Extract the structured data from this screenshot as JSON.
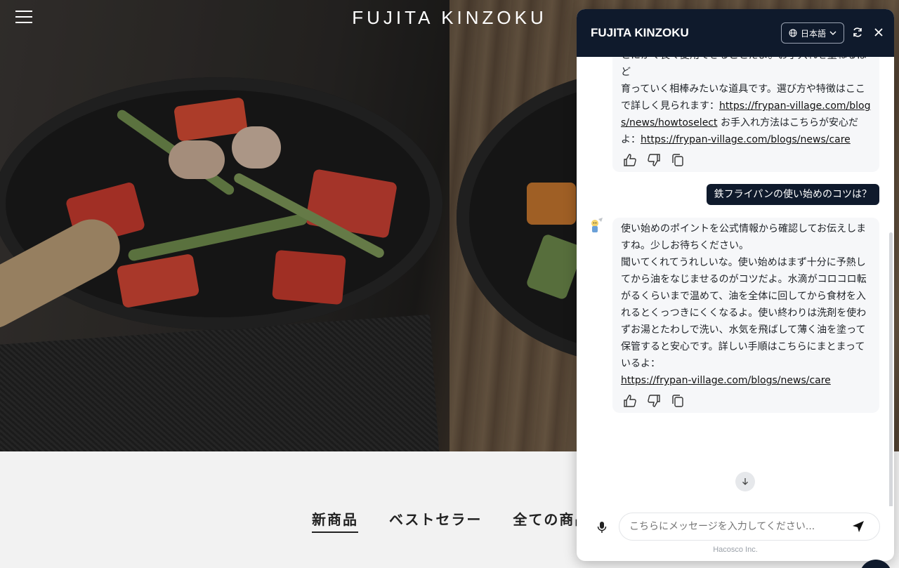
{
  "site": {
    "brand": "FUJITA KINZOKU",
    "tabs": [
      {
        "label": "新商品",
        "active": true
      },
      {
        "label": "ベストセラー",
        "active": false
      },
      {
        "label": "全ての商品",
        "active": false
      }
    ]
  },
  "chat": {
    "title": "FUJITA KINZOKU",
    "language": "日本語",
    "messages": {
      "first_bot": {
        "clipped_line": "とにかく長く愛用できることだよ。お手入れを重ねるほど",
        "text_1": "育っていく相棒みたいな道具です。選び方や特徴はここで詳しく見られます：",
        "link_1": "https://frypan-village.com/blogs/news/howtoselect",
        "text_2": " お手入れ方法はこちらが安心だよ：",
        "link_2": "https://frypan-village.com/blogs/news/care"
      },
      "user": "鉄フライパンの使い始めのコツは？",
      "second_bot": {
        "text_1": "使い始めのポイントを公式情報から確認してお伝えしますね。少しお待ちください。",
        "text_2": "聞いてくれてうれしいな。使い始めはまず十分に予熱してから油をなじませるのがコツだよ。水滴がコロコロ転がるくらいまで温めて、油を全体に回してから食材を入れるとくっつきにくくなるよ。使い終わりは洗剤を使わずお湯とたわしで洗い、水気を飛ばして薄く油を塗って保管すると安心です。詳しい手順はこちらにまとまっているよ：",
        "link": "https://frypan-village.com/blogs/news/care"
      }
    },
    "input_placeholder": "こちらにメッセージを入力してください...",
    "footer": "Hacosco Inc."
  },
  "icons": [
    "menu-icon",
    "globe-icon",
    "chevron-down-icon",
    "refresh-icon",
    "close-icon",
    "thumbs-up-icon",
    "thumbs-down-icon",
    "copy-icon",
    "arrow-down-icon",
    "mic-icon",
    "send-icon",
    "avatar-icon"
  ],
  "colors": {
    "header_bg": "#0f1a2c",
    "bubble_bg": "#f6f7f9",
    "user_bubble": "#0f1a2c"
  }
}
